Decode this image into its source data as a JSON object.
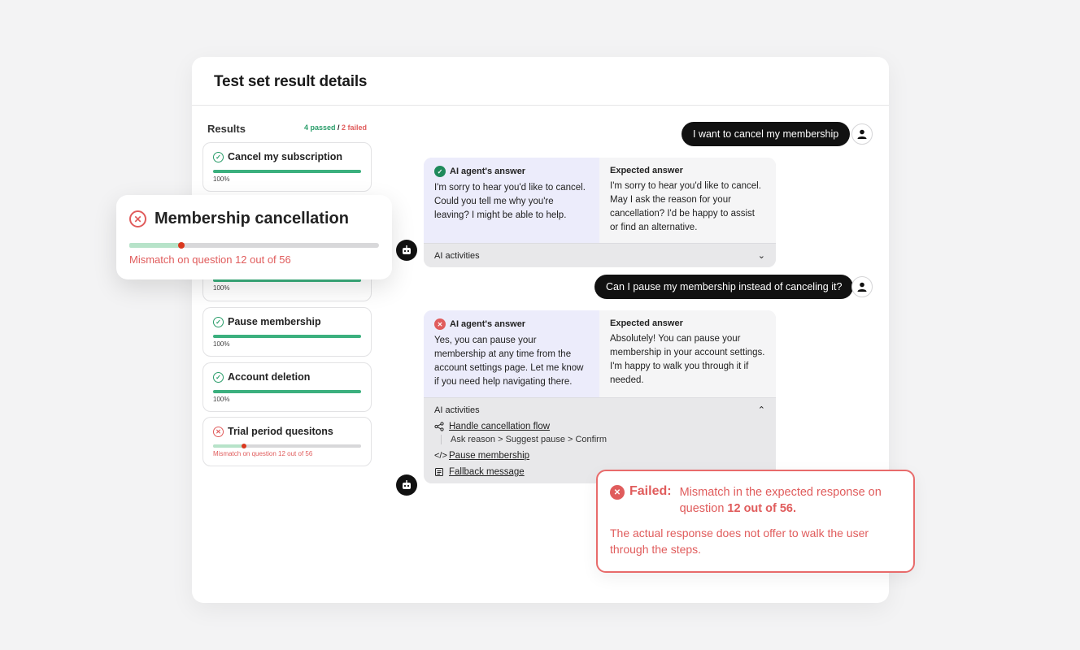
{
  "panel": {
    "title": "Test set result details"
  },
  "results": {
    "title": "Results",
    "passed": "4 passed",
    "sep": " / ",
    "failed": "2 failed",
    "cards": [
      {
        "name": "Cancel my subscription",
        "status": "pass",
        "label": "100%"
      },
      {
        "name": "",
        "status": "pass",
        "label": "100%"
      },
      {
        "name": "Pause membership",
        "status": "pass",
        "label": "100%"
      },
      {
        "name": "Account deletion",
        "status": "pass",
        "label": "100%"
      },
      {
        "name": "Trial period quesitons",
        "status": "fail",
        "label": "Mismatch on question 12 out of 56",
        "progress": 0.21
      }
    ]
  },
  "popup": {
    "title": "Membership cancellation",
    "mismatch": "Mismatch on question 12 out of 56",
    "progress": 0.21
  },
  "chat": {
    "q1": "I want to cancel my membership",
    "a1": {
      "ai_head": "AI agent's answer",
      "ai_text": "I'm sorry to hear you'd like to cancel. Could you tell me why you're leaving? I might be able to help.",
      "exp_head": "Expected answer",
      "exp_text": "I'm sorry to hear you'd like to cancel. May I ask the reason for your cancellation? I'd be happy to assist or find an alternative.",
      "activities": "AI activities"
    },
    "q2": "Can I pause my membership instead of canceling it?",
    "a2": {
      "ai_head": "AI agent's answer",
      "ai_text": "Yes, you can pause your membership at any time from the account settings page. Let me know if you need help navigating there.",
      "exp_head": "Expected answer",
      "exp_text": "Absolutely! You can pause your membership in your account settings. I'm happy to walk you through it if needed.",
      "activities": "AI activities",
      "items": {
        "flow": "Handle cancellation flow",
        "flow_sub": "Ask reason > Suggest pause > Confirm",
        "pause": "Pause membership",
        "fallback": "Fallback message"
      }
    }
  },
  "fail": {
    "label": "Failed:",
    "msg_a": "Mismatch in the expected response on question ",
    "msg_b": "12 out of 56.",
    "detail": "The actual response does not offer to walk the user through the steps."
  }
}
